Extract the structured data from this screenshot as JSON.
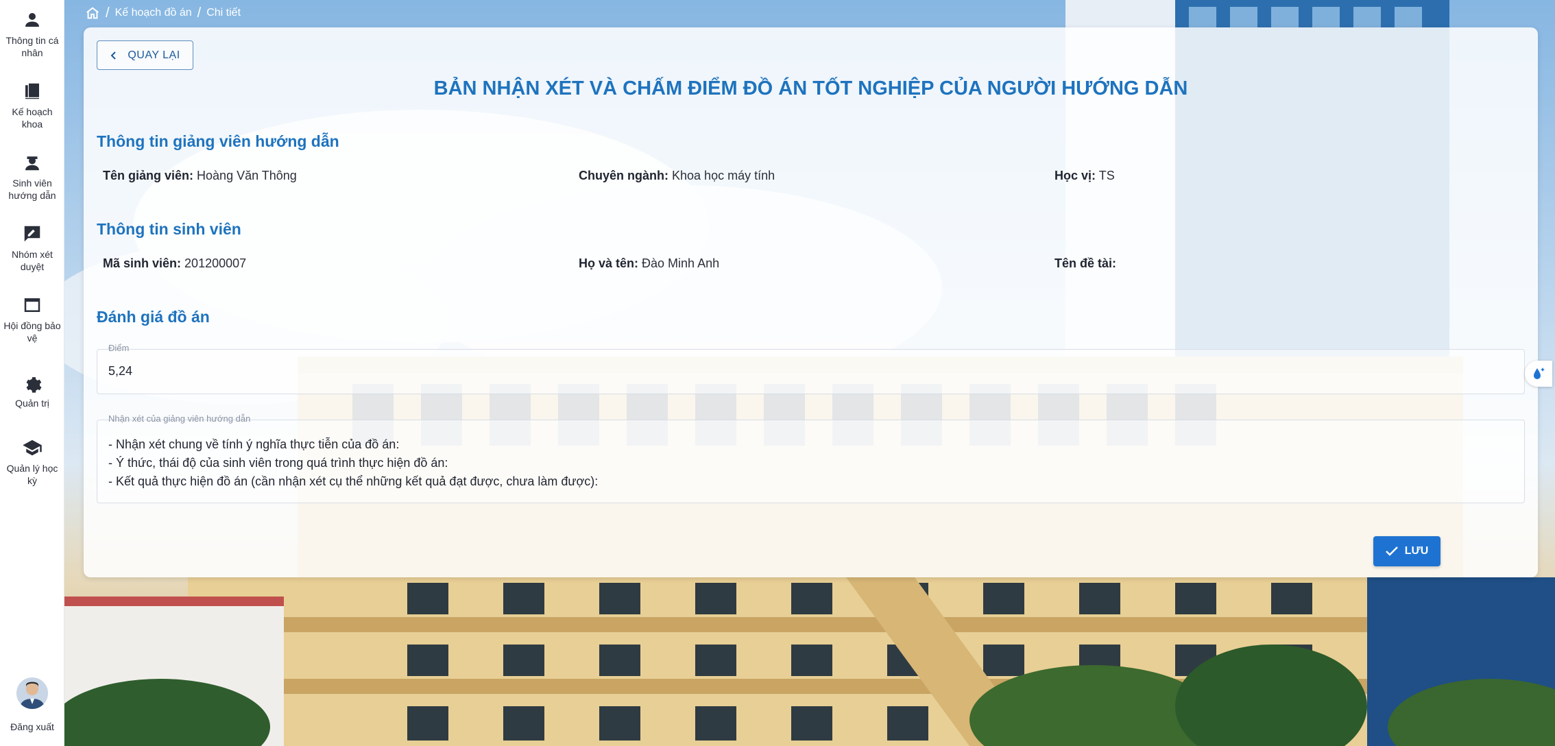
{
  "sidebar": {
    "items": [
      {
        "label": "Thông tin cá nhân",
        "icon": "person-icon"
      },
      {
        "label": "Kế hoạch khoa",
        "icon": "book-icon"
      },
      {
        "label": "Sinh viên hướng dẫn",
        "icon": "student-icon"
      },
      {
        "label": "Nhóm xét duyệt",
        "icon": "review-icon"
      },
      {
        "label": "Hội đồng bảo vệ",
        "icon": "window-icon"
      },
      {
        "label": "Quản trị",
        "icon": "gear-icon"
      },
      {
        "label": "Quản lý học kỳ",
        "icon": "graduation-cap-icon"
      }
    ],
    "logout_label": "Đăng xuất"
  },
  "breadcrumb": {
    "items": [
      "Kế hoạch đồ án",
      "Chi tiết"
    ]
  },
  "card": {
    "back_label": "QUAY LẠI",
    "title": "BẢN NHẬN XÉT VÀ CHẤM ĐIỂM ĐỒ ÁN TỐT NGHIỆP CỦA NGƯỜI HƯỚNG DẪN",
    "advisor_section": {
      "title": "Thông tin giảng viên hướng dẫn",
      "fields": [
        {
          "label": "Tên giảng viên:",
          "value": "Hoàng Văn Thông"
        },
        {
          "label": "Chuyên ngành:",
          "value": "Khoa học máy tính"
        },
        {
          "label": "Học vị:",
          "value": "TS"
        }
      ]
    },
    "student_section": {
      "title": "Thông tin sinh viên",
      "fields": [
        {
          "label": "Mã sinh viên:",
          "value": "201200007"
        },
        {
          "label": "Họ và tên:",
          "value": "Đào Minh Anh"
        },
        {
          "label": "Tên đề tài:",
          "value": ""
        }
      ]
    },
    "evaluation_section": {
      "title": "Đánh giá đồ án",
      "score_label": "Điểm",
      "score_value": "5,24",
      "comment_label": "Nhận xét của giảng viên hướng dẫn",
      "comment_lines": [
        "- Nhận xét chung về tính ý nghĩa thực tiễn của đồ án:",
        "- Ý thức, thái độ của sinh viên trong quá trình thực hiện đồ án:",
        "- Kết quả thực hiện đồ án (cần nhận xét cụ thể những kết quả đạt được, chưa làm được):"
      ]
    },
    "save_label": "LƯU"
  },
  "colors": {
    "accent": "#1e73be",
    "button": "#1e73d2"
  }
}
